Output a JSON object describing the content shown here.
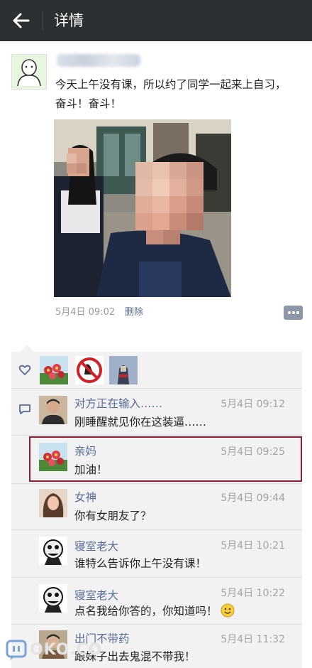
{
  "header": {
    "back_icon": "arrow-left-icon",
    "title": "详情"
  },
  "post": {
    "text": "今天上午没有课，所以约了同学一起来上自习，奋斗！奋斗！",
    "date": "5月4日 09:02",
    "delete_label": "删除"
  },
  "likes": {
    "icon": "heart-icon",
    "count_avatars": 3
  },
  "comments": [
    {
      "name": "对方正在输入……",
      "time": "5月4日 09:12",
      "text": "刚睡醒就见你在这装逼……"
    },
    {
      "name": "亲妈",
      "time": "5月4日 09:25",
      "text": "加油！"
    },
    {
      "name": "女神",
      "time": "5月4日 09:44",
      "text": "你有女朋友了？"
    },
    {
      "name": "寝室老大",
      "time": "5月4日 10:21",
      "text": "谁特么告诉你上午没有课！"
    },
    {
      "name": "寝室老大",
      "time": "5月4日 10:22",
      "text": "点名我给你答的，你知道吗！"
    },
    {
      "name": "出门不带药",
      "time": "5月4日 11:32",
      "text": "跟妹子出去鬼混不带我！"
    }
  ],
  "colors": {
    "topbar": "#2c3033",
    "link": "#576b95",
    "highlight": "#8a2038",
    "panel": "#f2f2f2"
  },
  "watermark": {
    "text": "OKO.CO"
  }
}
